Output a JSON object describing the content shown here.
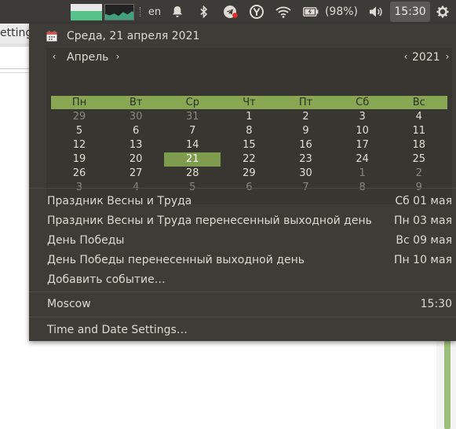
{
  "background": {
    "tab_fragment": "etting"
  },
  "panel": {
    "language": "en",
    "battery_percent": "(98%)",
    "clock": "15:30"
  },
  "menu": {
    "date_header": "Среда, 21 апреля 2021",
    "month_label": "Апрель",
    "year_label": "2021",
    "prev": "‹",
    "next": "›",
    "weekdays": [
      "Пн",
      "Вт",
      "Ср",
      "Чт",
      "Пт",
      "Сб",
      "Вс"
    ],
    "weeks": [
      [
        "29",
        "30",
        "31",
        "1",
        "2",
        "3",
        "4"
      ],
      [
        "5",
        "6",
        "7",
        "8",
        "9",
        "10",
        "11"
      ],
      [
        "12",
        "13",
        "14",
        "15",
        "16",
        "17",
        "18"
      ],
      [
        "19",
        "20",
        "21",
        "22",
        "23",
        "24",
        "25"
      ],
      [
        "26",
        "27",
        "28",
        "29",
        "30",
        "1",
        "2"
      ],
      [
        "3",
        "4",
        "5",
        "6",
        "7",
        "8",
        "9"
      ]
    ],
    "events": [
      {
        "title": "Праздник Весны и Труда",
        "when": "Сб 01 мая"
      },
      {
        "title": "Праздник Весны и Труда перенесенный выходной день",
        "when": "Пн 03 мая"
      },
      {
        "title": "День Победы",
        "when": "Вс 09 мая"
      },
      {
        "title": "День Победы перенесенный выходной день",
        "when": "Пн 10 мая"
      }
    ],
    "add_event": "Добавить событие…",
    "location": {
      "city": "Moscow",
      "time": "15:30"
    },
    "settings": "Time and Date Settings…"
  },
  "colors": {
    "panel_bg": "#3c3b37",
    "menu_bg": "#3d3c37",
    "accent_green": "#87a752",
    "today_green": "#7e9c4d"
  }
}
